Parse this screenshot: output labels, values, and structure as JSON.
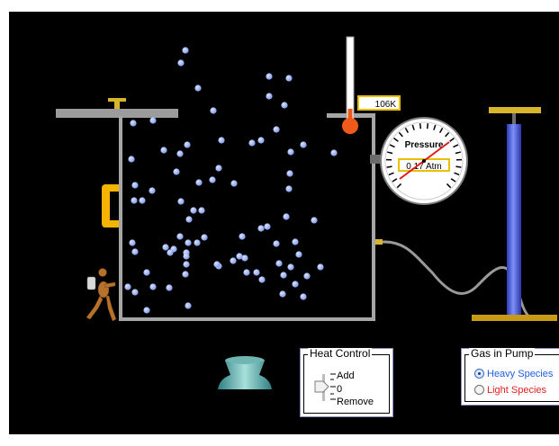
{
  "thermometer": {
    "temperature_label": "106K"
  },
  "gauge": {
    "title": "Pressure",
    "reading": "0.17 Atm"
  },
  "heat_control": {
    "title": "Heat Control",
    "add_label": "Add",
    "zero_label": "0",
    "remove_label": "Remove",
    "slider_value": 0
  },
  "gas_in_pump": {
    "title": "Gas in Pump",
    "options": [
      {
        "label": "Heavy Species",
        "selected": true,
        "color": "#1f5ee8"
      },
      {
        "label": "Light Species",
        "selected": false,
        "color": "#e22020"
      }
    ]
  },
  "colors": {
    "particle": "#8fa8f0",
    "wall": "#a6a6a6",
    "handle": "#f6b400",
    "pump_barrel": "#3a4fd0",
    "pump_base": "#c99a16",
    "thermometer_fluid": "#ef5a1a"
  }
}
